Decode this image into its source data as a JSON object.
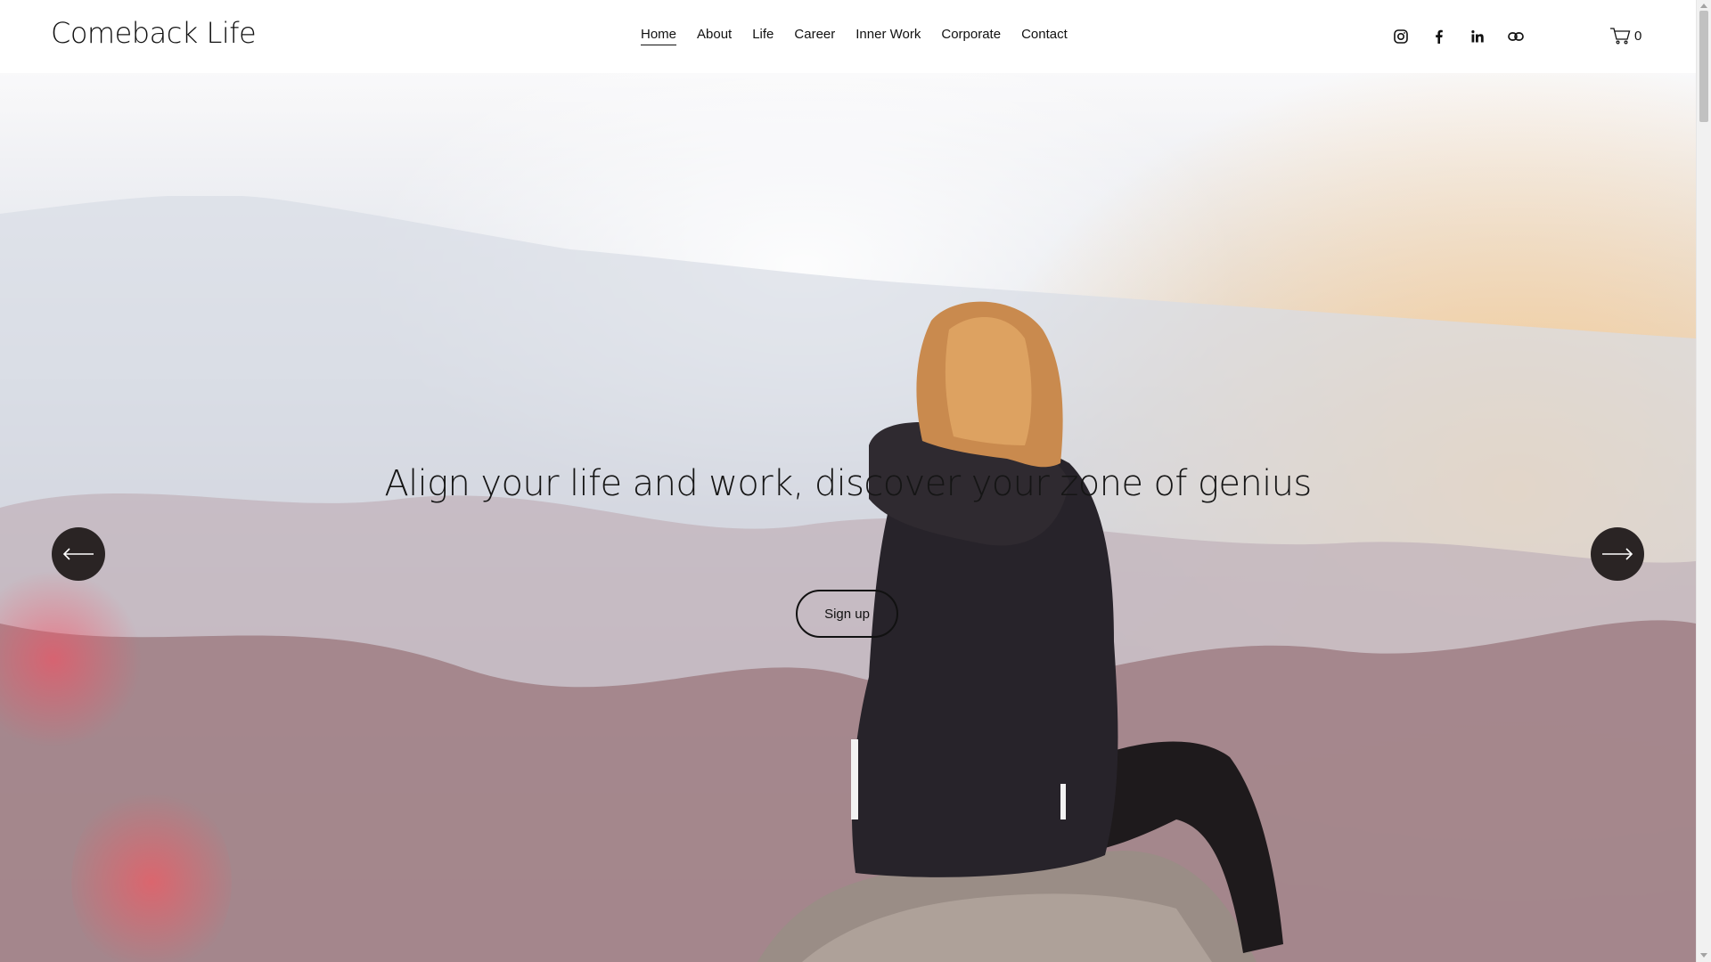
{
  "site": {
    "logo": "Comeback Life"
  },
  "nav": {
    "items": [
      {
        "label": "Home",
        "active": true
      },
      {
        "label": "About"
      },
      {
        "label": "Life"
      },
      {
        "label": "Career"
      },
      {
        "label": "Inner Work"
      },
      {
        "label": "Corporate"
      },
      {
        "label": "Contact"
      }
    ]
  },
  "social": {
    "icons": [
      "instagram-icon",
      "facebook-icon",
      "linkedin-icon",
      "link-icon"
    ]
  },
  "cart": {
    "icon": "cart-icon",
    "count": "0"
  },
  "hero": {
    "headline": "Align your life and work, discover your zone of genius",
    "cta_label": "Sign up",
    "prev_icon": "arrow-left-icon",
    "next_icon": "arrow-right-icon"
  },
  "colors": {
    "text": "#111111",
    "arrow_bg": "#2a2424",
    "header_bg": "#ffffff"
  }
}
